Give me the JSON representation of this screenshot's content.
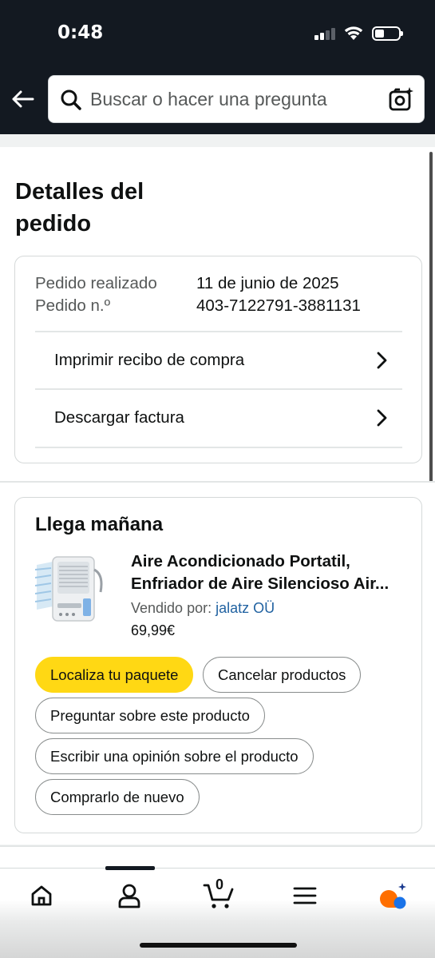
{
  "status_bar": {
    "time": "0:48"
  },
  "header": {
    "search_placeholder": "Buscar o hacer una pregunta"
  },
  "page": {
    "title": "Detalles del pedido"
  },
  "order": {
    "placed_label": "Pedido realizado",
    "placed_value": "11 de junio de 2025",
    "number_label": "Pedido n.º",
    "number_value": "403-7122791-3881131",
    "print_receipt": "Imprimir recibo de compra",
    "download_invoice": "Descargar factura"
  },
  "shipment": {
    "title": "Llega mañana",
    "product_title_line1": "Aire Acondicionado Portatil,",
    "product_title_line2": "Enfriador de Aire Silencioso Air...",
    "sold_by_label": "Vendido por: ",
    "seller": "jalatz OÜ",
    "price": "69,99€",
    "buttons": {
      "track": "Localiza tu paquete",
      "cancel": "Cancelar productos",
      "ask": "Preguntar sobre este producto",
      "review": "Escribir una opinión sobre el producto",
      "buy_again": "Comprarlo de nuevo"
    }
  },
  "bottom_nav": {
    "cart_count": "0",
    "items": [
      "home-icon",
      "account-icon",
      "cart-icon",
      "menu-icon",
      "rufus-icon"
    ]
  },
  "colors": {
    "header_bg": "#131921",
    "primary_button": "#ffd814",
    "link": "#2162a1"
  }
}
